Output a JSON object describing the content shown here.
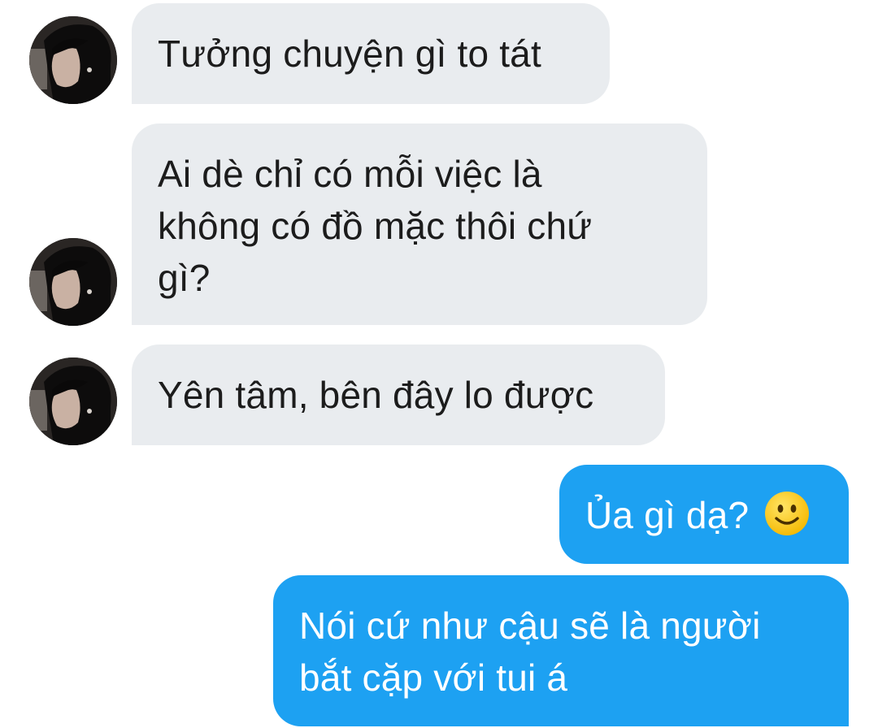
{
  "conversation": {
    "messages": [
      {
        "sender": "other",
        "text": "Tưởng chuyện gì to tát"
      },
      {
        "sender": "other",
        "lines": [
          "Ai dè chỉ có mỗi việc là",
          "không có đồ mặc thôi chứ",
          "gì?"
        ]
      },
      {
        "sender": "other",
        "text": "Yên tâm, bên đây lo được"
      },
      {
        "sender": "me",
        "text": "Ủa gì dạ?",
        "emoji": "slightly-smiling-face-icon"
      },
      {
        "sender": "me",
        "lines": [
          "Nói cứ như cậu sẽ là người",
          "bắt cặp với tui á"
        ]
      }
    ]
  },
  "colors": {
    "incoming_bubble": "#e9ecef",
    "outgoing_bubble": "#1da1f2",
    "incoming_text": "#1c1c1c",
    "outgoing_text": "#ffffff",
    "background": "#ffffff"
  }
}
